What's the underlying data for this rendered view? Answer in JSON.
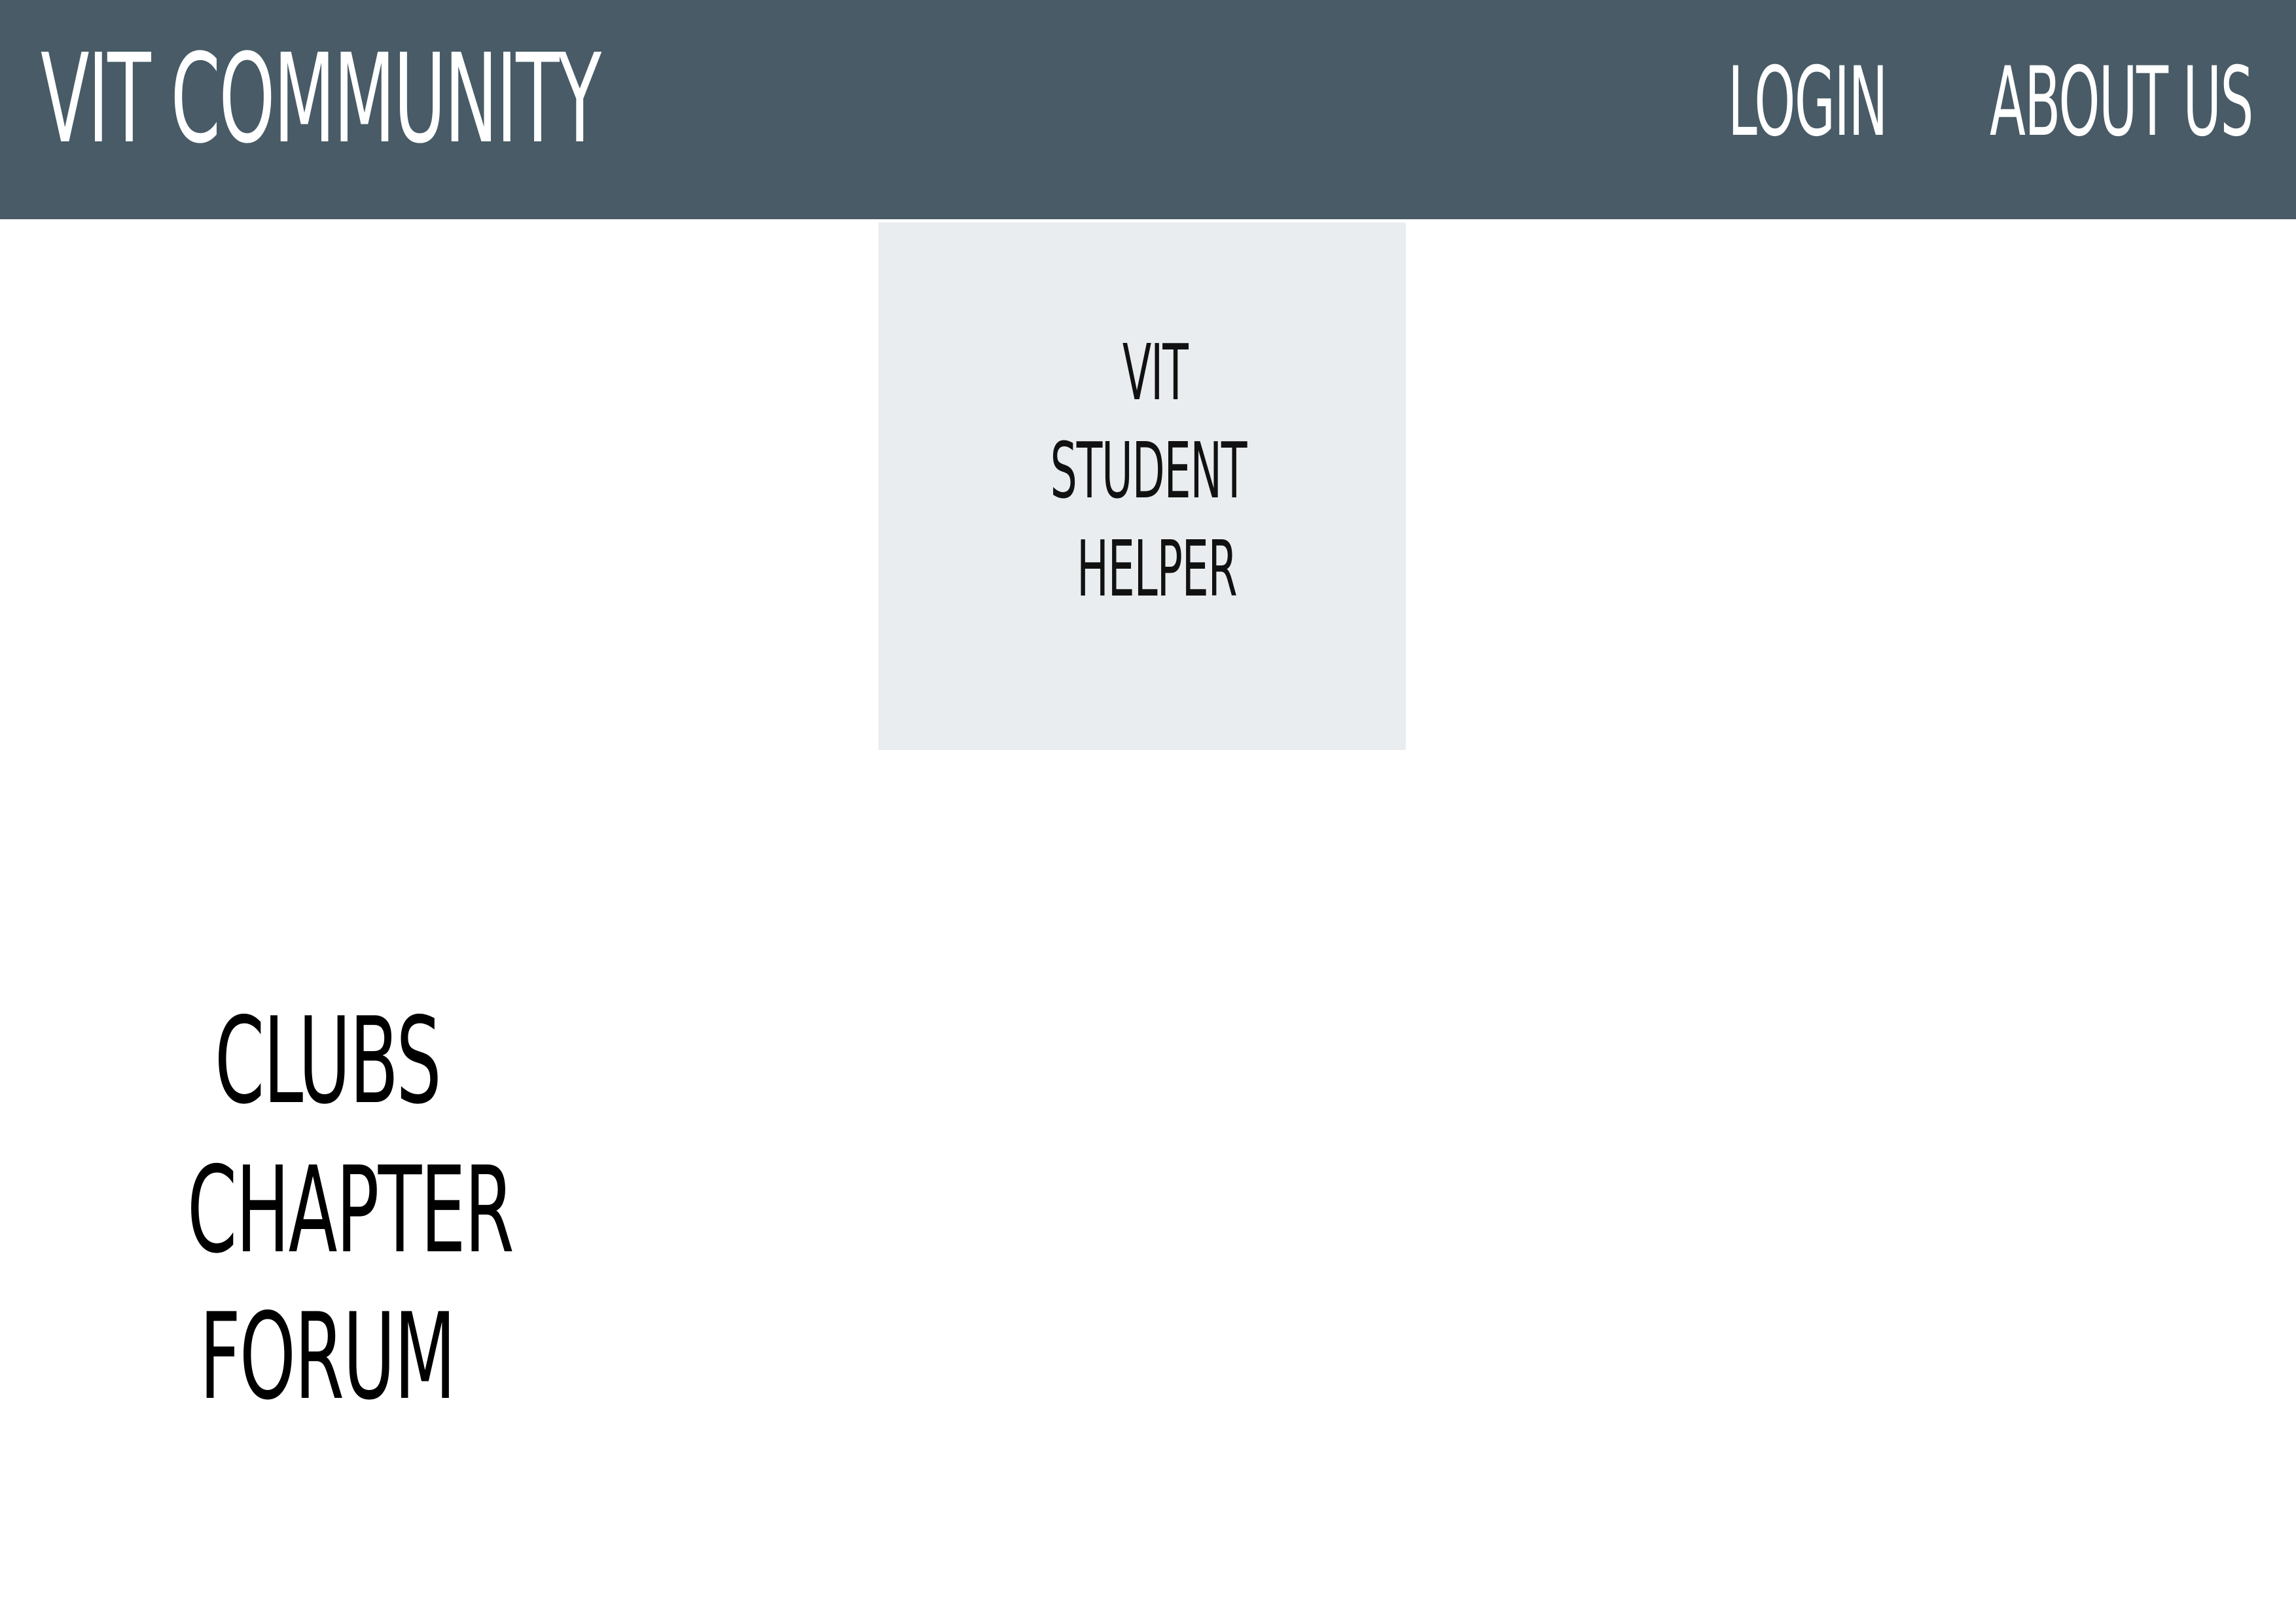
{
  "header": {
    "brand": "VIT COMMUNITY",
    "nav": {
      "login": "LOGIN",
      "about": "ABOUT US"
    }
  },
  "card": {
    "lines": [
      "VIT",
      "STUDENT",
      "HELPER"
    ]
  },
  "menu": {
    "items": [
      "CLUBS",
      "CHAPTER",
      "FORUM"
    ]
  },
  "colors": {
    "header_bg": "#485b66",
    "card_bg": "#eaedf0",
    "header_text": "#ffffff",
    "body_text": "#000000"
  }
}
